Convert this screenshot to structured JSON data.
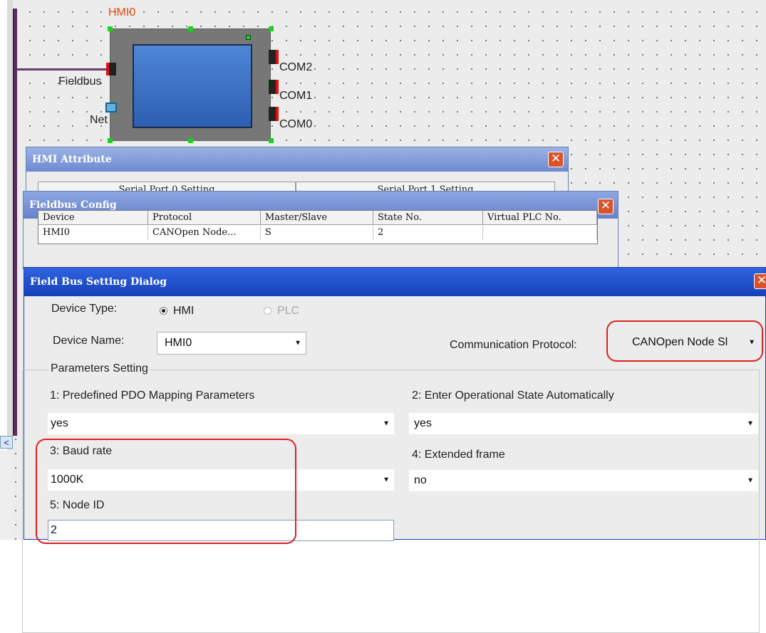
{
  "canvas": {
    "hmi_label": "HMI0",
    "fieldbus_label": "Fieldbus",
    "net_label": "Net",
    "ports": [
      "COM2",
      "COM1",
      "COM0"
    ],
    "scroll_left_glyph": "<"
  },
  "hmi_attribute": {
    "title": "HMI Attribute",
    "close_glyph": "✕",
    "tabs": [
      "Serial Port 0 Setting",
      "Serial Port 1 Setting"
    ]
  },
  "fieldbus_config": {
    "title": "Fieldbus Config",
    "close_glyph": "✕",
    "columns": [
      "Device",
      "Protocol",
      "Master/Slave",
      "State No.",
      "Virtual PLC No."
    ],
    "rows": [
      [
        "HMI0",
        "CANOpen Node...",
        "S",
        "2",
        ""
      ]
    ]
  },
  "field_bus_dialog": {
    "title": "Field Bus Setting Dialog",
    "close_glyph": "✕",
    "device_type_label": "Device Type:",
    "device_type_options": [
      {
        "label": "HMI",
        "selected": true,
        "enabled": true
      },
      {
        "label": "PLC",
        "selected": false,
        "enabled": false
      }
    ],
    "device_name_label": "Device Name:",
    "device_name_value": "HMI0",
    "protocol_label": "Communication Protocol:",
    "protocol_value": "CANOpen Node Sl",
    "group_title": "Parameters Setting",
    "params": [
      {
        "label": "1: Predefined PDO Mapping Parameters",
        "value": "yes"
      },
      {
        "label": "2: Enter Operational State Automatically",
        "value": "yes"
      },
      {
        "label": "3: Baud rate",
        "value": "1000K"
      },
      {
        "label": "4: Extended frame",
        "value": "no"
      },
      {
        "label": "5: Node ID",
        "value": "2"
      }
    ]
  },
  "colors": {
    "titlebar_active": "#1b47c4",
    "titlebar_inactive": "#7b96d8",
    "highlight_red": "#e01f1f",
    "bus_purple": "#5a2d5f"
  }
}
